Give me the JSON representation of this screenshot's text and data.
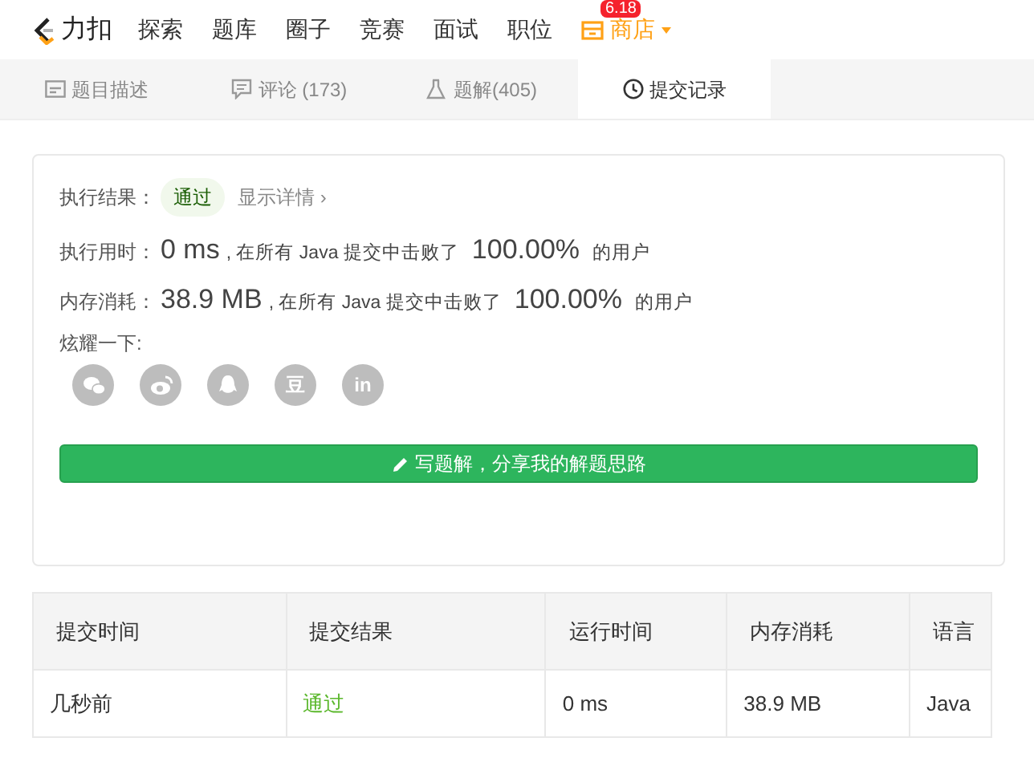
{
  "nav": {
    "logo_text": "力扣",
    "items": [
      {
        "label": "探索",
        "selected": false
      },
      {
        "label": "题库",
        "selected": false
      },
      {
        "label": "圈子",
        "selected": false
      },
      {
        "label": "竞赛",
        "selected": false
      },
      {
        "label": "面试",
        "selected": false
      },
      {
        "label": "职位",
        "selected": false
      }
    ],
    "shop": {
      "label": "商店",
      "badge": "6.18"
    }
  },
  "tabs": [
    {
      "label": "题目描述",
      "kind": "doc",
      "selected": false
    },
    {
      "label": "评论 (173)",
      "kind": "comment",
      "selected": false
    },
    {
      "label": "题解(405)",
      "kind": "flask",
      "selected": false
    },
    {
      "label": "提交记录",
      "kind": "clock",
      "selected": true
    }
  ],
  "result": {
    "label": "执行结果：",
    "status": "通过",
    "passed": true,
    "details_link": "显示详情 ›"
  },
  "stats": [
    {
      "label": "执行用时：",
      "value": "0 ms",
      "text": ", 在所有 Java 提交中击败了",
      "percent": "100.00%",
      "suffix": "的用户"
    },
    {
      "label": "内存消耗：",
      "value": "38.9 MB",
      "text": ", 在所有 Java 提交中击败了",
      "percent": "100.00%",
      "suffix": "的用户"
    }
  ],
  "share": {
    "label": "炫耀一下:",
    "icons": [
      {
        "kind": "chat"
      },
      {
        "kind": "swirl"
      },
      {
        "kind": "penguin"
      },
      {
        "kind": "text",
        "text": "豆"
      },
      {
        "kind": "text",
        "text": "in"
      }
    ]
  },
  "write_button": "写题解，分享我的解题思路",
  "table": {
    "columns": [
      "提交时间",
      "提交结果",
      "运行时间",
      "内存消耗",
      "语言"
    ],
    "rows": [
      {
        "cells": [
          "几秒前",
          "通过",
          "0 ms",
          "38.9 MB",
          "Java"
        ],
        "passed": true
      }
    ]
  }
}
